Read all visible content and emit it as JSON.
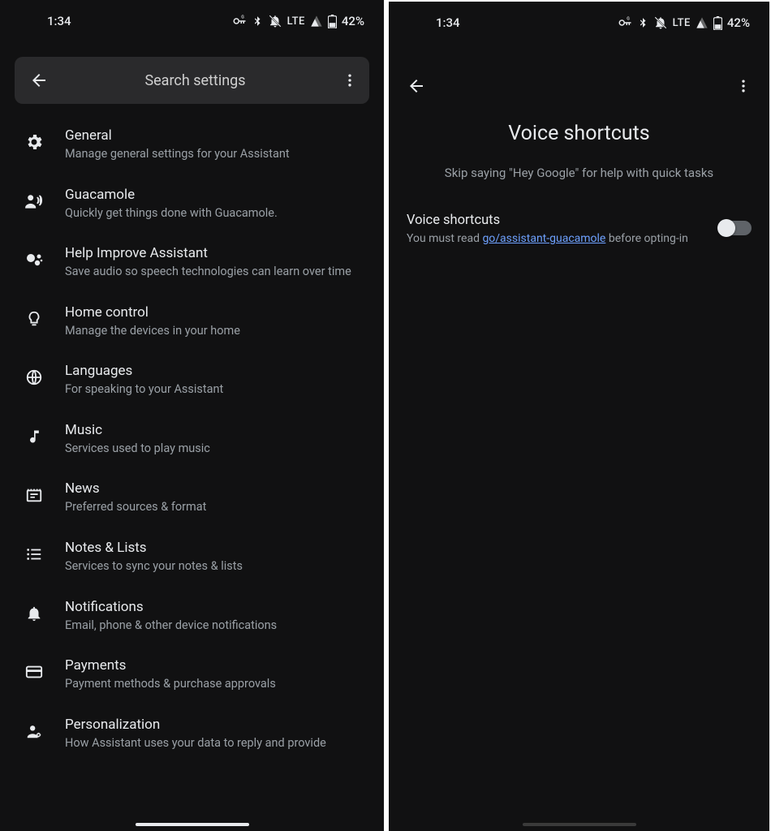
{
  "status": {
    "time": "1:34",
    "network": "LTE",
    "battery": "42%"
  },
  "left": {
    "search_placeholder": "Search settings",
    "items": [
      {
        "title": "General",
        "sub": "Manage general settings for your Assistant",
        "icon": "gear-icon"
      },
      {
        "title": "Guacamole",
        "sub": "Quickly get things done with Guacamole.",
        "icon": "voice-icon"
      },
      {
        "title": "Help Improve Assistant",
        "sub": "Save audio so speech technologies can learn over time",
        "icon": "assistant-icon"
      },
      {
        "title": "Home control",
        "sub": "Manage the devices in your home",
        "icon": "bulb-icon"
      },
      {
        "title": "Languages",
        "sub": "For speaking to your Assistant",
        "icon": "globe-icon"
      },
      {
        "title": "Music",
        "sub": "Services used to play music",
        "icon": "music-icon"
      },
      {
        "title": "News",
        "sub": "Preferred sources & format",
        "icon": "news-icon"
      },
      {
        "title": "Notes & Lists",
        "sub": "Services to sync your notes & lists",
        "icon": "list-icon"
      },
      {
        "title": "Notifications",
        "sub": "Email, phone & other device notifications",
        "icon": "bell-icon"
      },
      {
        "title": "Payments",
        "sub": "Payment methods & purchase approvals",
        "icon": "card-icon"
      },
      {
        "title": "Personalization",
        "sub": "How Assistant uses your data to reply and provide",
        "icon": "person-icon"
      }
    ]
  },
  "right": {
    "title": "Voice shortcuts",
    "subtitle": "Skip saying \"Hey Google\" for help with quick tasks",
    "setting_title": "Voice shortcuts",
    "setting_sub_pre": "You must read ",
    "setting_link": "go/assistant-guacamole",
    "setting_sub_post": " before opting-in",
    "toggle_on": false
  }
}
